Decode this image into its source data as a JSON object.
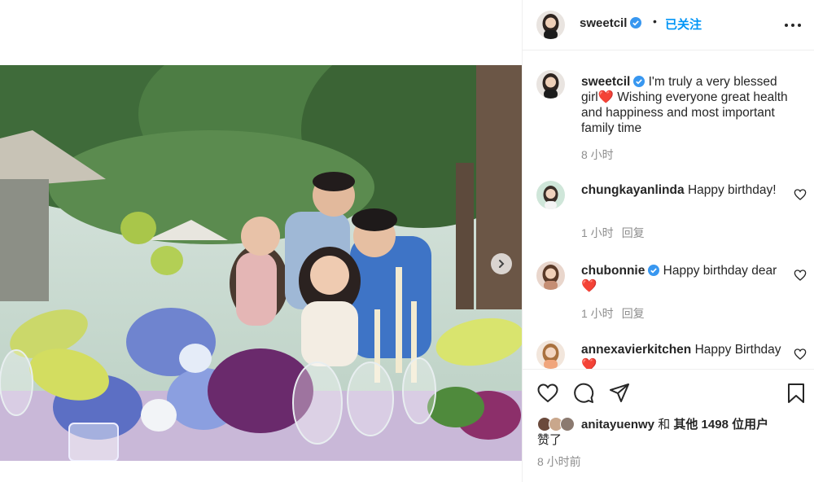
{
  "header": {
    "username": "sweetcil",
    "separator": "•",
    "follow_status": "已关注",
    "accent_color": "#0095f6",
    "verified_color": "#3897f0"
  },
  "media": {
    "description_icon": "party-photo",
    "next_button_icon": "chevron-right-icon"
  },
  "caption": {
    "username": "sweetcil",
    "text": "I'm truly a very blessed girl❤️  Wishing everyone great health and happiness and most important family time",
    "time": "8 小时"
  },
  "comments": [
    {
      "username": "chungkayanlinda",
      "verified": false,
      "text": "Happy birthday!",
      "time": "1 小时",
      "reply": "回复"
    },
    {
      "username": "chubonnie",
      "verified": true,
      "text": "Happy birthday dear ❤️",
      "time": "1 小时",
      "reply": "回复"
    },
    {
      "username": "annexavierkitchen",
      "verified": false,
      "text": "Happy Birthday ❤️",
      "time": "",
      "reply": ""
    }
  ],
  "likes": {
    "first_user": "anitayuenwy",
    "connector": "和",
    "others": "其他 1498 位用户",
    "suffix": "赞了"
  },
  "post_time": "8 小时前",
  "icons": [
    "heart-icon",
    "comment-icon",
    "share-icon",
    "bookmark-icon",
    "more-icon"
  ]
}
